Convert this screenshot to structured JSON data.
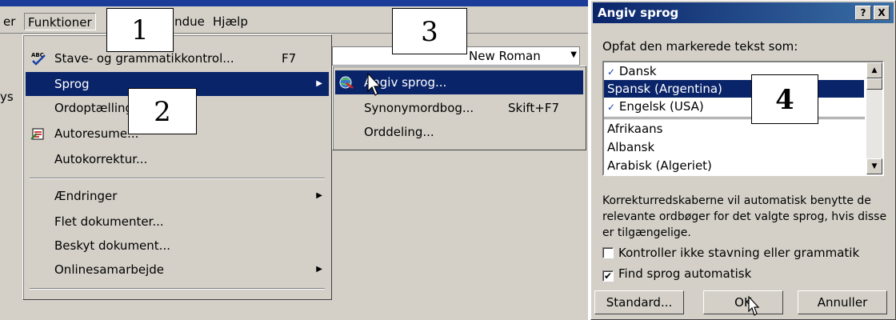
{
  "menubar": {
    "items": [
      {
        "label": "er"
      },
      {
        "label": "Funktioner"
      },
      {
        "label": "Vindue"
      },
      {
        "label": "Hjælp"
      }
    ]
  },
  "toolbar": {
    "font_name": "New Roman",
    "left_fragments": [
      "ys"
    ]
  },
  "tools_menu": {
    "items": [
      {
        "label": "Stave- og grammatikkontrol...",
        "shortcut": "F7",
        "icon": "spellcheck-icon"
      },
      {
        "label": "Sprog",
        "submenu": true,
        "selected": true
      },
      {
        "label": "Ordoptælling...",
        "icon": ""
      },
      {
        "label": "Autoresume...",
        "icon": "autosummary-icon"
      },
      {
        "label": "Autokorrektur..."
      },
      {
        "label": "Ændringer",
        "submenu": true
      },
      {
        "label": "Flet dokumenter..."
      },
      {
        "label": "Beskyt dokument..."
      },
      {
        "label": "Onlinesamarbejde",
        "submenu": true
      }
    ]
  },
  "language_menu": {
    "items": [
      {
        "label": "Angiv sprog...",
        "selected": true,
        "icon": "language-globe-icon"
      },
      {
        "label": "Synonymordbog...",
        "shortcut": "Skift+F7"
      },
      {
        "label": "Orddeling..."
      }
    ]
  },
  "callouts": [
    "1",
    "2",
    "3",
    "4"
  ],
  "dialog": {
    "title": "Angiv sprog",
    "help_button": "?",
    "close_button": "X",
    "prompt": "Opfat den markerede tekst som:",
    "languages": [
      {
        "label": "Dansk",
        "spellcheck": true
      },
      {
        "label": "Spansk (Argentina)",
        "selected": true
      },
      {
        "label": "Engelsk (USA)",
        "spellcheck": true
      },
      {
        "label": "Afrikaans"
      },
      {
        "label": "Albansk"
      },
      {
        "label": "Arabisk (Algeriet)"
      }
    ],
    "description": "Korrekturredskaberne vil automatisk benytte de relevante ordbøger for det valgte sprog, hvis disse er tilgængelige.",
    "checkbox_no_check": {
      "label": "Kontroller ikke stavning eller grammatik",
      "checked": false
    },
    "checkbox_auto": {
      "label": "Find sprog automatisk",
      "checked": true
    },
    "buttons": {
      "default": "Standard...",
      "ok": "OK",
      "cancel": "Annuller"
    }
  },
  "colors": {
    "menu_face": "#d4d0c8",
    "highlight": "#0a246a",
    "titlebar_start": "#0a246a",
    "titlebar_end": "#3a6ea5"
  }
}
